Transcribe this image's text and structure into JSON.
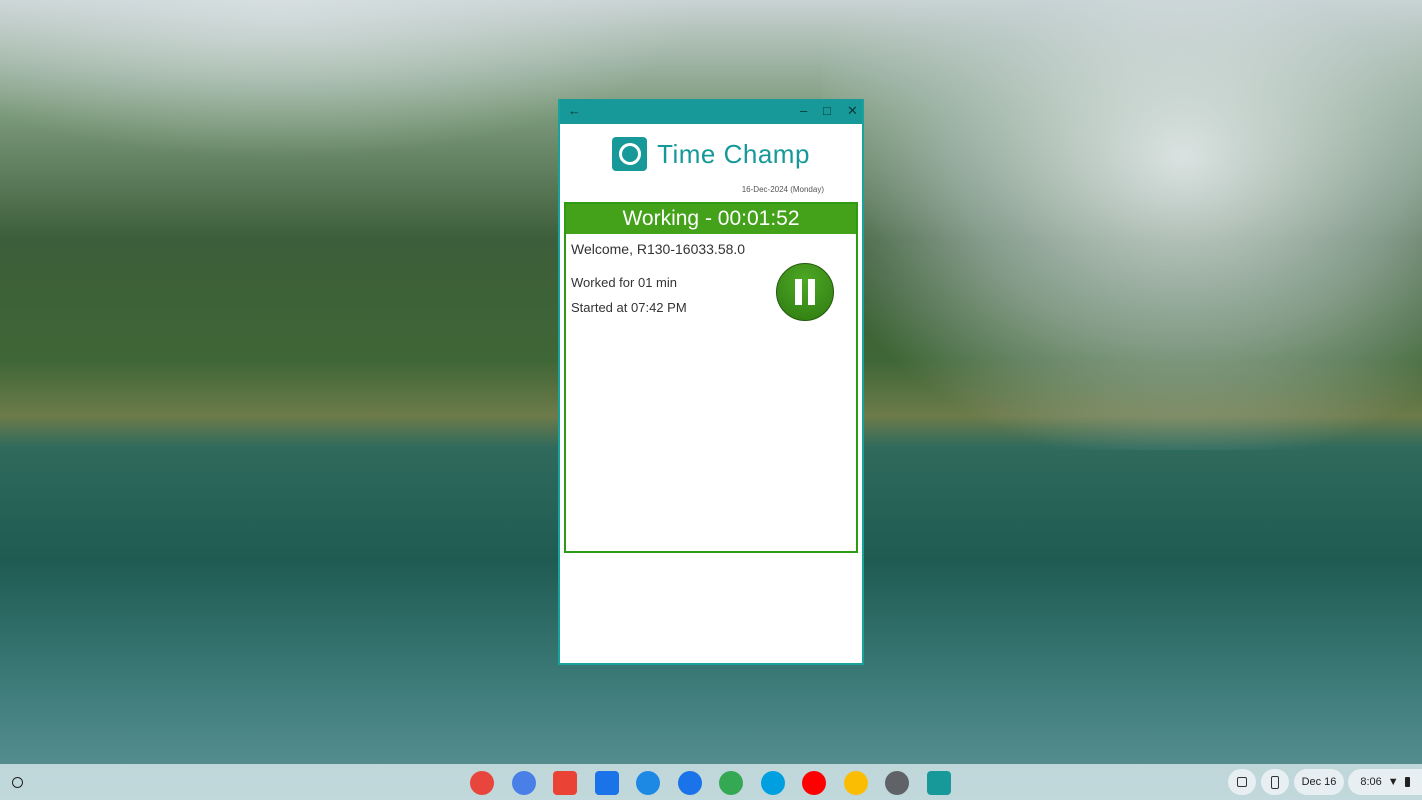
{
  "window": {
    "back": "←",
    "minimize": "–",
    "maximize": "□",
    "close": "✕"
  },
  "app": {
    "title": "Time Champ",
    "date": "16-Dec-2024 (Monday)",
    "status": "Working - 00:01:52",
    "welcome": "Welcome, R130-16033.58.0",
    "worked_label": "Worked for",
    "worked_value": "01 min",
    "started_label": "Started at",
    "started_value": "07:42 PM"
  },
  "taskbar": {
    "apps": [
      {
        "name": "chrome",
        "color": "#e8453c"
      },
      {
        "name": "gemini",
        "color": "#4a7fe8"
      },
      {
        "name": "gmail",
        "color": "#ea4335"
      },
      {
        "name": "calendar",
        "color": "#1a73e8"
      },
      {
        "name": "files",
        "color": "#1e88e5"
      },
      {
        "name": "messages",
        "color": "#1a73e8"
      },
      {
        "name": "meet",
        "color": "#34a853"
      },
      {
        "name": "play-store",
        "color": "#00a0e0"
      },
      {
        "name": "youtube",
        "color": "#ff0000"
      },
      {
        "name": "photos",
        "color": "#fbbc04"
      },
      {
        "name": "settings",
        "color": "#5f6368"
      },
      {
        "name": "time-champ",
        "color": "#17999a"
      }
    ],
    "date": "Dec 16",
    "time": "8:06"
  }
}
